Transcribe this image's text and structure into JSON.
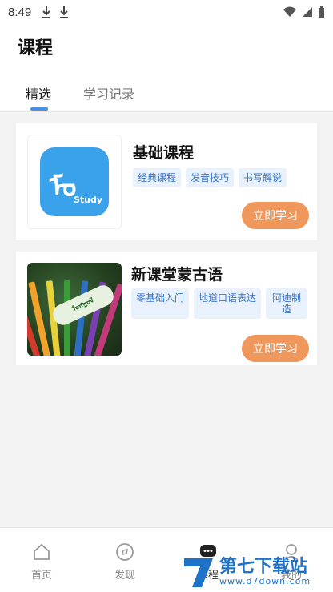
{
  "status_bar": {
    "time": "8:49"
  },
  "header": {
    "title": "课程"
  },
  "tabs": [
    {
      "label": "精选"
    },
    {
      "label": "学习记录"
    }
  ],
  "courses": [
    {
      "title": "基础课程",
      "thumb_text": "Study",
      "tags": [
        "经典课程",
        "发音技巧",
        "书写解说"
      ],
      "button": "立即学习"
    },
    {
      "title": "新课堂蒙古语",
      "tags": [
        "零基础入门",
        "地道口语表达",
        "阿迪制造"
      ],
      "button": "立即学习"
    }
  ],
  "bottom_nav": [
    {
      "label": "首页",
      "icon": "home-icon"
    },
    {
      "label": "发现",
      "icon": "compass-icon"
    },
    {
      "label": "课程",
      "icon": "chat-icon"
    },
    {
      "label": "我的",
      "icon": "user-icon"
    }
  ],
  "watermark": {
    "brand": "第七下载站",
    "url": "www.d7down.com"
  },
  "colors": {
    "accent": "#4a90e2",
    "button": "#f0975c",
    "tag_bg": "#e8f1fc",
    "tag_text": "#3a74c8"
  }
}
